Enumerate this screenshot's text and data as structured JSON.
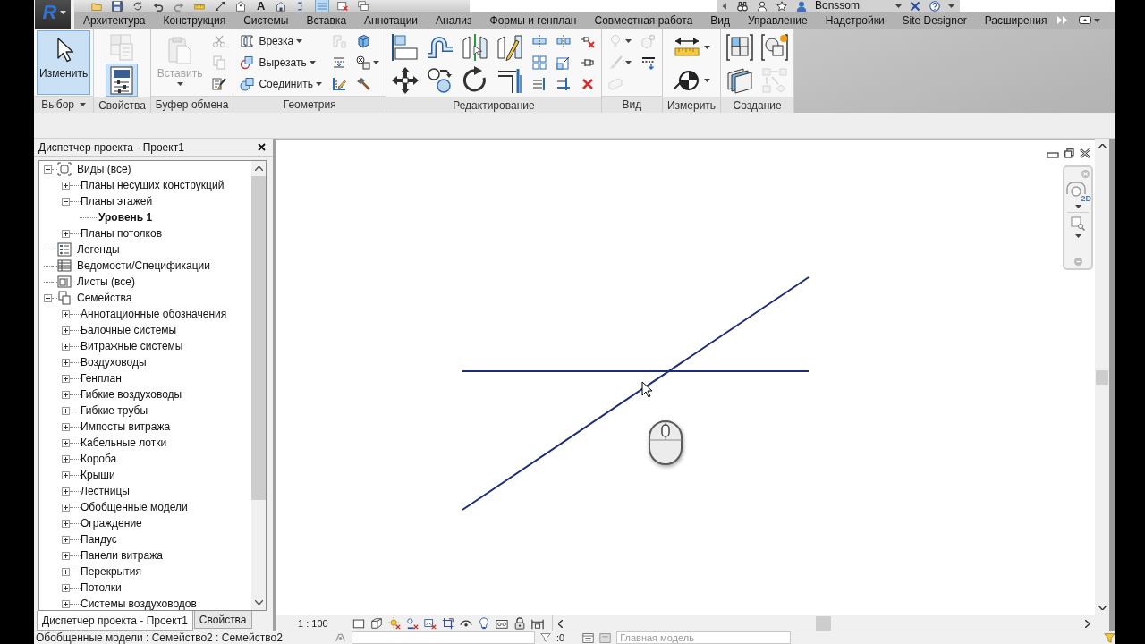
{
  "app_menu": {
    "label": "R"
  },
  "quick_access_toolbar": {
    "text_tool": "A"
  },
  "info_center": {
    "user_name": "Bonssom"
  },
  "ribbon": {
    "tabs": [
      "Архитектура",
      "Конструкция",
      "Системы",
      "Вставка",
      "Аннотации",
      "Анализ",
      "Формы и генплан",
      "Совместная работа",
      "Вид",
      "Управление",
      "Надстройки",
      "Site Designer",
      "Расширения"
    ],
    "panels": [
      {
        "label": "Выбор",
        "menu": true,
        "columns": [
          [
            {
              "kind": "modify",
              "label": "Изменить",
              "active": true,
              "disabled": false,
              "dropdown": false
            }
          ]
        ]
      },
      {
        "label": "Свойства",
        "menu": false,
        "columns": [
          [
            {
              "kind": "type_properties",
              "active": false,
              "disabled": true,
              "dropdown": false
            },
            {
              "kind": "properties",
              "active": true,
              "disabled": false,
              "dropdown": false
            }
          ]
        ]
      },
      {
        "label": "Буфер обмена",
        "menu": false,
        "columns": [
          [
            {
              "kind": "paste",
              "label": "Вставить",
              "active": false,
              "disabled": true,
              "dropdown": true
            }
          ],
          [
            {
              "kind": "cut",
              "active": false,
              "disabled": true,
              "dropdown": false
            },
            {
              "kind": "copy",
              "active": false,
              "disabled": true,
              "dropdown": false
            },
            {
              "kind": "match",
              "active": false,
              "disabled": false,
              "dropdown": false
            }
          ]
        ]
      },
      {
        "label": "Геометрия",
        "menu": false,
        "columns": [
          [
            {
              "kind": "cope",
              "label": "Врезка",
              "active": false,
              "disabled": false,
              "dropdown": true
            },
            {
              "kind": "cut_geometry",
              "label": "Вырезать",
              "active": false,
              "disabled": false,
              "dropdown": true
            },
            {
              "kind": "join",
              "label": "Соединить",
              "active": false,
              "disabled": false,
              "dropdown": true
            }
          ],
          [
            {
              "kind": "wall_joins",
              "active": false,
              "disabled": true,
              "dropdown": false
            },
            {
              "kind": "split_face",
              "active": false,
              "disabled": false,
              "dropdown": false
            },
            {
              "kind": "beam_joins",
              "active": false,
              "disabled": false,
              "dropdown": false
            }
          ],
          [
            {
              "kind": "paint",
              "active": false,
              "disabled": false,
              "dropdown": false
            },
            {
              "kind": "cut_toggle",
              "active": false,
              "disabled": false,
              "dropdown": true
            },
            {
              "kind": "demolish",
              "active": false,
              "disabled": false,
              "dropdown": false
            }
          ]
        ]
      },
      {
        "label": "Редактирование",
        "menu": false,
        "columns": [
          [
            {
              "kind": "align",
              "active": false,
              "disabled": false,
              "dropdown": false
            },
            {
              "kind": "move",
              "active": false,
              "disabled": false,
              "dropdown": false
            }
          ],
          [
            {
              "kind": "offset",
              "active": false,
              "disabled": false,
              "dropdown": false
            },
            {
              "kind": "copy_elements",
              "active": false,
              "disabled": false,
              "dropdown": false
            }
          ],
          [
            {
              "kind": "mirror_axis",
              "active": false,
              "disabled": false,
              "dropdown": false
            },
            {
              "kind": "rotate",
              "active": false,
              "disabled": false,
              "dropdown": false
            }
          ],
          [
            {
              "kind": "mirror_draw",
              "active": false,
              "disabled": false,
              "dropdown": false
            },
            {
              "kind": "trim",
              "active": false,
              "disabled": false,
              "dropdown": false
            }
          ],
          [
            {
              "kind": "split",
              "active": false,
              "disabled": false,
              "dropdown": false
            },
            {
              "kind": "array",
              "active": false,
              "disabled": false,
              "dropdown": false
            },
            {
              "kind": "trim_multi",
              "active": false,
              "disabled": false,
              "dropdown": false
            }
          ],
          [
            {
              "kind": "split_gap",
              "active": false,
              "disabled": false,
              "dropdown": false
            },
            {
              "kind": "scale",
              "active": false,
              "disabled": false,
              "dropdown": false
            },
            {
              "kind": "trim_single",
              "active": false,
              "disabled": false,
              "dropdown": false
            }
          ],
          [
            {
              "kind": "unpin",
              "active": false,
              "disabled": false,
              "dropdown": false
            },
            {
              "kind": "pin",
              "active": false,
              "disabled": false,
              "dropdown": false
            },
            {
              "kind": "delete",
              "active": false,
              "disabled": false,
              "dropdown": false
            }
          ]
        ]
      },
      {
        "label": "Вид",
        "menu": false,
        "columns": [
          [
            {
              "kind": "hide",
              "active": false,
              "disabled": true,
              "dropdown": true
            },
            {
              "kind": "override",
              "active": false,
              "disabled": true,
              "dropdown": true
            },
            {
              "kind": "isolate",
              "active": false,
              "disabled": true,
              "dropdown": false
            }
          ],
          [
            {
              "kind": "view_gear",
              "active": false,
              "disabled": true,
              "dropdown": false
            },
            {
              "kind": "linework",
              "active": false,
              "disabled": false,
              "dropdown": false
            }
          ]
        ]
      },
      {
        "label": "Измерить",
        "menu": false,
        "columns": [
          [
            {
              "kind": "dimension",
              "active": false,
              "disabled": false,
              "dropdown": true
            },
            {
              "kind": "spot",
              "active": false,
              "disabled": false,
              "dropdown": true
            }
          ]
        ]
      },
      {
        "label": "Создание",
        "menu": false,
        "columns": [
          [
            {
              "kind": "group",
              "active": false,
              "disabled": false,
              "dropdown": false
            },
            {
              "kind": "parts",
              "active": false,
              "disabled": false,
              "dropdown": false
            }
          ],
          [
            {
              "kind": "similar",
              "active": false,
              "disabled": false,
              "dropdown": false
            },
            {
              "kind": "assembly",
              "active": false,
              "disabled": true,
              "dropdown": false
            }
          ]
        ]
      }
    ]
  },
  "project_browser": {
    "title": "Диспетчер проекта - Проект1",
    "tree": [
      {
        "kind": "views",
        "label": "Виды (все)",
        "expandable": true,
        "expanded": true,
        "children": [
          {
            "label": "Планы несущих конструкций",
            "expandable": true,
            "expanded": false
          },
          {
            "label": "Планы этажей",
            "expandable": true,
            "expanded": true,
            "children": [
              {
                "label": "Уровень 1",
                "expandable": false,
                "expanded": false,
                "current": true
              }
            ]
          },
          {
            "label": "Планы потолков",
            "expandable": true,
            "expanded": false
          }
        ]
      },
      {
        "kind": "legends",
        "label": "Легенды",
        "expandable": false,
        "expanded": false
      },
      {
        "kind": "schedules",
        "label": "Ведомости/Спецификации",
        "expandable": false,
        "expanded": false
      },
      {
        "kind": "sheets",
        "label": "Листы (все)",
        "expandable": false,
        "expanded": false
      },
      {
        "kind": "families",
        "label": "Семейства",
        "expandable": true,
        "expanded": true,
        "children": [
          {
            "label": "Аннотационные обозначения",
            "expandable": true,
            "expanded": false
          },
          {
            "label": "Балочные системы",
            "expandable": true,
            "expanded": false
          },
          {
            "label": "Витражные системы",
            "expandable": true,
            "expanded": false
          },
          {
            "label": "Воздуховоды",
            "expandable": true,
            "expanded": false
          },
          {
            "label": "Генплан",
            "expandable": true,
            "expanded": false
          },
          {
            "label": "Гибкие воздуховоды",
            "expandable": true,
            "expanded": false
          },
          {
            "label": "Гибкие трубы",
            "expandable": true,
            "expanded": false
          },
          {
            "label": "Импосты витража",
            "expandable": true,
            "expanded": false
          },
          {
            "label": "Кабельные лотки",
            "expandable": true,
            "expanded": false
          },
          {
            "label": "Короба",
            "expandable": true,
            "expanded": false
          },
          {
            "label": "Крыши",
            "expandable": true,
            "expanded": false
          },
          {
            "label": "Лестницы",
            "expandable": true,
            "expanded": false
          },
          {
            "label": "Обобщенные модели",
            "expandable": true,
            "expanded": false
          },
          {
            "label": "Ограждение",
            "expandable": true,
            "expanded": false
          },
          {
            "label": "Пандус",
            "expandable": true,
            "expanded": false
          },
          {
            "label": "Панели витража",
            "expandable": true,
            "expanded": false
          },
          {
            "label": "Перекрытия",
            "expandable": true,
            "expanded": false
          },
          {
            "label": "Потолки",
            "expandable": true,
            "expanded": false
          },
          {
            "label": "Системы воздуховодов",
            "expandable": true,
            "expanded": false
          }
        ]
      }
    ],
    "tabs": [
      {
        "label": "Диспетчер проекта - Проект1",
        "selected": true
      },
      {
        "label": "Свойства",
        "selected": false
      }
    ]
  },
  "view": {
    "navigation_bar": {
      "wheel_label": "2D"
    },
    "view_control_bar": {
      "scale": "1 : 100"
    }
  },
  "status_bar": {
    "hint": "Обобщенные модели : Семейство2 : Семейство2",
    "filter_count": ":0",
    "design_option": {
      "value": "Главная модель",
      "disabled": true
    }
  }
}
